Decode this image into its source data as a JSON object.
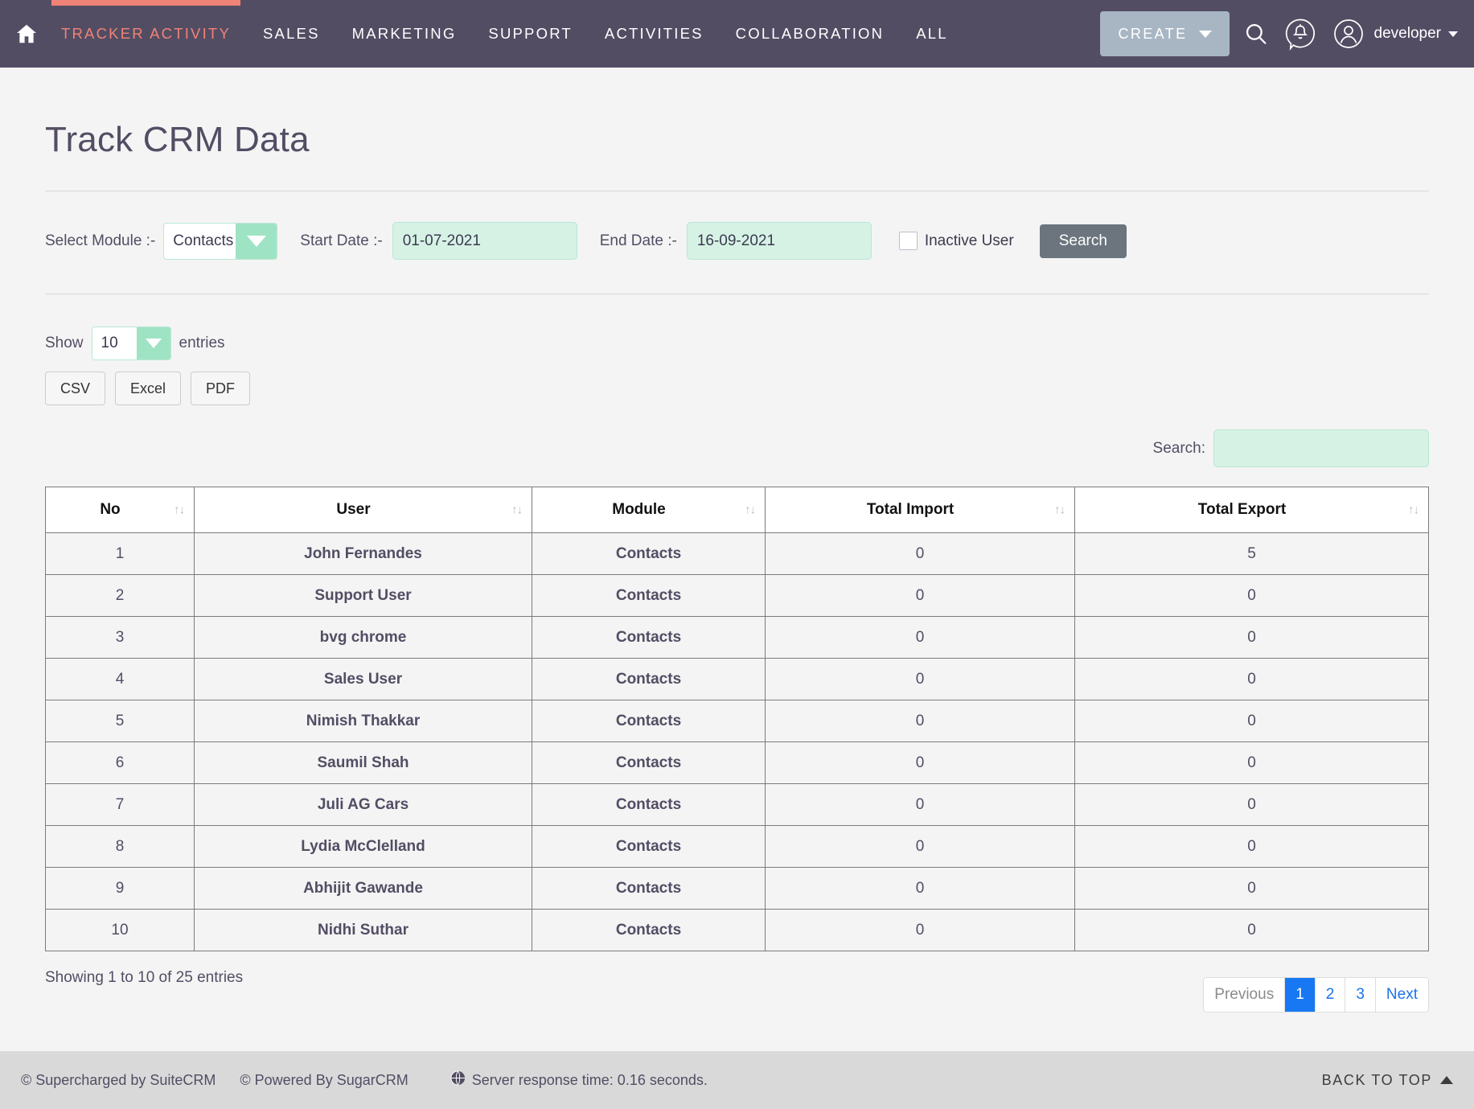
{
  "navbar": {
    "home_icon": "home-icon",
    "menu": [
      {
        "label": "TRACKER ACTIVITY",
        "active": true
      },
      {
        "label": "SALES",
        "active": false
      },
      {
        "label": "MARKETING",
        "active": false
      },
      {
        "label": "SUPPORT",
        "active": false
      },
      {
        "label": "ACTIVITIES",
        "active": false
      },
      {
        "label": "COLLABORATION",
        "active": false
      },
      {
        "label": "ALL",
        "active": false
      }
    ],
    "create_label": "CREATE",
    "search_icon": "search-icon",
    "notification_icon": "notification-bell-icon",
    "avatar_icon": "user-avatar-icon",
    "username": "developer",
    "accent_color": "#f08377",
    "bar_color": "#534d64",
    "create_bg": "#a8b6c4"
  },
  "page": {
    "title": "Track CRM Data"
  },
  "filters": {
    "module_label": "Select Module :-",
    "module_value": "Contacts",
    "start_date_label": "Start Date :-",
    "start_date_value": "01-07-2021",
    "end_date_label": "End Date :-",
    "end_date_value": "16-09-2021",
    "inactive_user_label": "Inactive User",
    "inactive_user_checked": false,
    "search_button": "Search"
  },
  "table_controls": {
    "show_label": "Show",
    "entries_label": "entries",
    "page_length": "10",
    "exports": [
      "CSV",
      "Excel",
      "PDF"
    ],
    "search_label": "Search:",
    "search_value": "",
    "search_placeholder": ""
  },
  "table": {
    "columns": [
      {
        "label": "No",
        "sort_icon": "↑↓"
      },
      {
        "label": "User",
        "sort_icon": "↑↓"
      },
      {
        "label": "Module",
        "sort_icon": "↑↓"
      },
      {
        "label": "Total Import",
        "sort_icon": "↑↓"
      },
      {
        "label": "Total Export",
        "sort_icon": "↑↓"
      }
    ],
    "rows": [
      {
        "no": "1",
        "user": "John Fernandes",
        "module": "Contacts",
        "total_import": "0",
        "total_export": "5"
      },
      {
        "no": "2",
        "user": "Support User",
        "module": "Contacts",
        "total_import": "0",
        "total_export": "0"
      },
      {
        "no": "3",
        "user": "bvg chrome",
        "module": "Contacts",
        "total_import": "0",
        "total_export": "0"
      },
      {
        "no": "4",
        "user": "Sales User",
        "module": "Contacts",
        "total_import": "0",
        "total_export": "0"
      },
      {
        "no": "5",
        "user": "Nimish Thakkar",
        "module": "Contacts",
        "total_import": "0",
        "total_export": "0"
      },
      {
        "no": "6",
        "user": "Saumil Shah",
        "module": "Contacts",
        "total_import": "0",
        "total_export": "0"
      },
      {
        "no": "7",
        "user": "Juli AG Cars",
        "module": "Contacts",
        "total_import": "0",
        "total_export": "0"
      },
      {
        "no": "8",
        "user": "Lydia McClelland",
        "module": "Contacts",
        "total_import": "0",
        "total_export": "0"
      },
      {
        "no": "9",
        "user": "Abhijit Gawande",
        "module": "Contacts",
        "total_import": "0",
        "total_export": "0"
      },
      {
        "no": "10",
        "user": "Nidhi Suthar",
        "module": "Contacts",
        "total_import": "0",
        "total_export": "0"
      }
    ],
    "number_color": "#f06e61"
  },
  "pagination": {
    "showing_text": "Showing 1 to 10 of 25 entries",
    "previous_label": "Previous",
    "next_label": "Next",
    "pages": [
      "1",
      "2",
      "3"
    ],
    "active_page": "1",
    "active_color": "#1878f3"
  },
  "footer": {
    "suitecrm": "© Supercharged by SuiteCRM",
    "sugarcrm": "© Powered By SugarCRM",
    "globe_icon": "globe-icon",
    "server_time": "Server response time: 0.16 seconds.",
    "back_to_top": "BACK TO TOP"
  }
}
